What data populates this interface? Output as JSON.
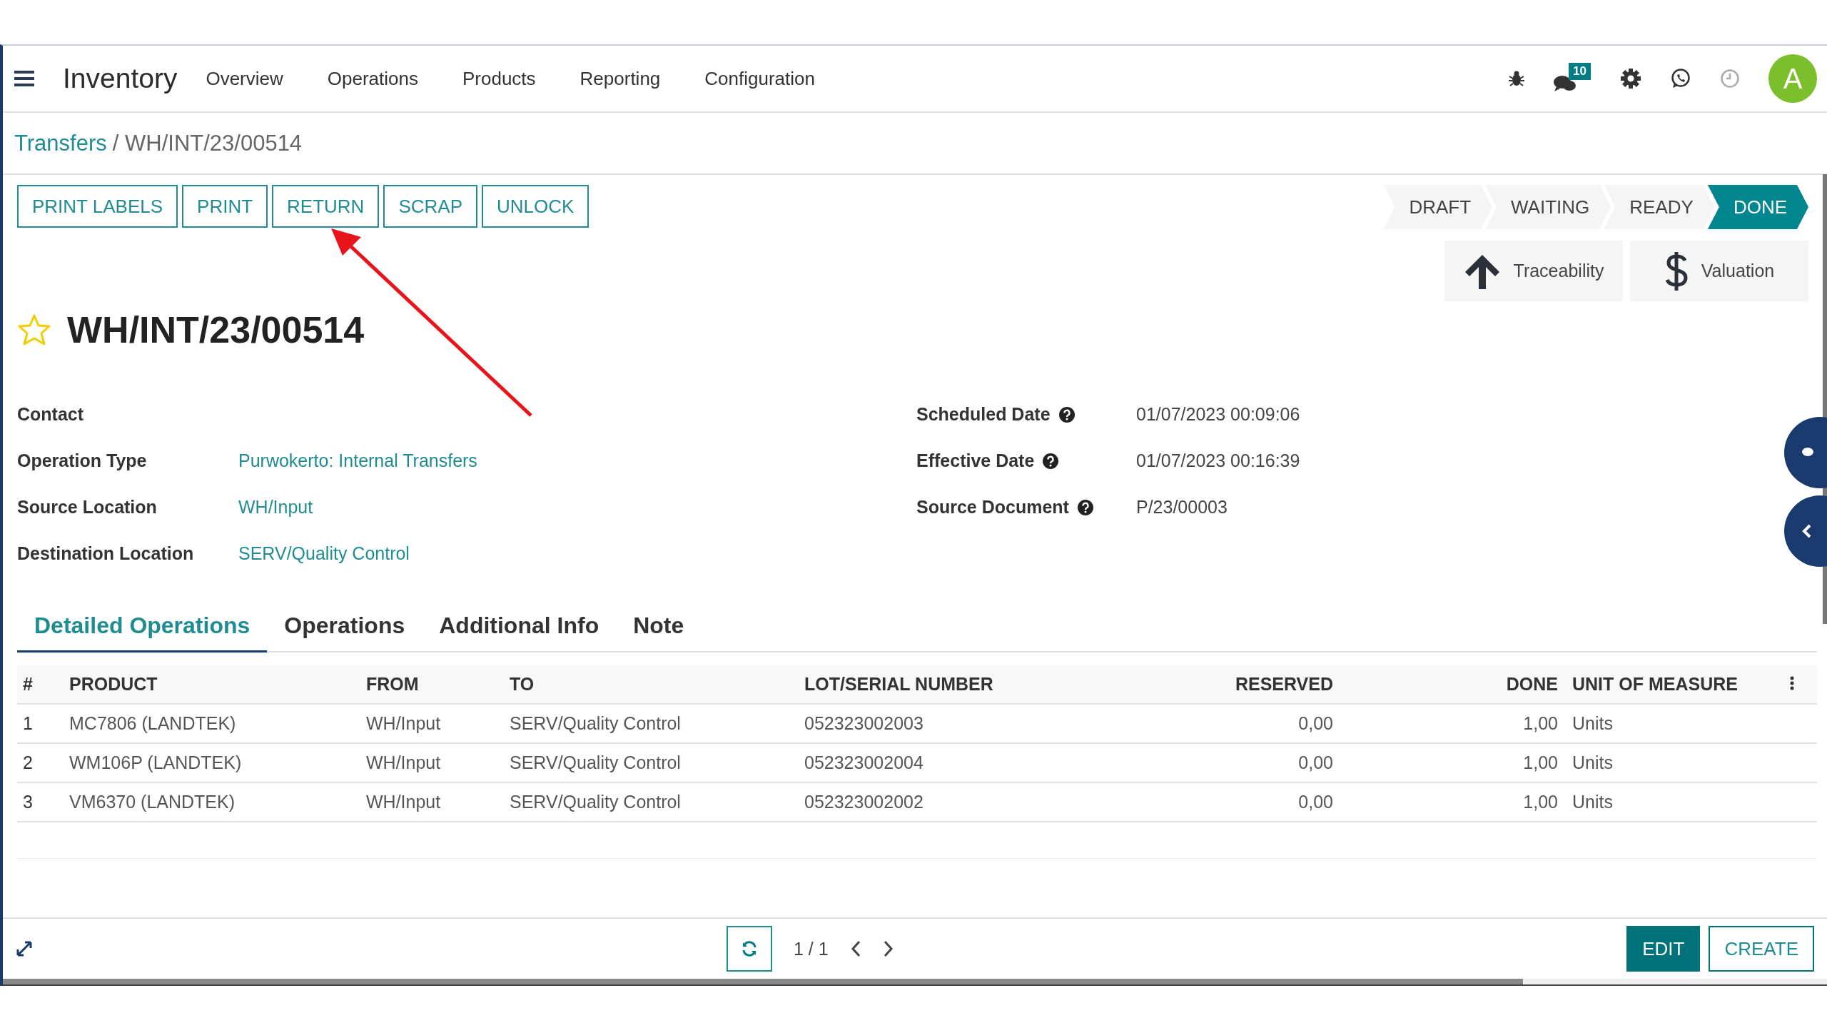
{
  "app": {
    "name": "Inventory",
    "menu": [
      "Overview",
      "Operations",
      "Products",
      "Reporting",
      "Configuration"
    ]
  },
  "systray": {
    "chat_badge": "10",
    "avatar": "A"
  },
  "breadcrumb": {
    "parent": "Transfers",
    "current": "/ WH/INT/23/00514"
  },
  "action_buttons": [
    "PRINT LABELS",
    "PRINT",
    "RETURN",
    "SCRAP",
    "UNLOCK"
  ],
  "status_steps": [
    {
      "label": "DRAFT",
      "selected": false
    },
    {
      "label": "WAITING",
      "selected": false
    },
    {
      "label": "READY",
      "selected": false
    },
    {
      "label": "DONE",
      "selected": true
    }
  ],
  "smart_buttons": [
    {
      "label": "Traceability",
      "kind": "arrow"
    },
    {
      "label": "Valuation",
      "kind": "dollar"
    }
  ],
  "record": {
    "title": "WH/INT/23/00514",
    "starred": false
  },
  "fields_left": [
    {
      "label": "Contact"
    },
    {
      "label": "Operation Type",
      "value": "Purwokerto: Internal Transfers"
    },
    {
      "label": "Source Location",
      "value": "WH/Input"
    },
    {
      "label": "Destination Location",
      "value": "SERV/Quality Control"
    }
  ],
  "fields_right": [
    {
      "label": "Scheduled Date",
      "value": "01/07/2023 00:09:06"
    },
    {
      "label": "Effective Date",
      "value": "01/07/2023 00:16:39"
    },
    {
      "label": "Source Document",
      "value": "P/23/00003"
    }
  ],
  "tabs": [
    {
      "label": "Detailed Operations",
      "selected": true
    },
    {
      "label": "Operations",
      "selected": false
    },
    {
      "label": "Additional Info",
      "selected": false
    },
    {
      "label": "Note",
      "selected": false
    }
  ],
  "table": {
    "columns": [
      {
        "label": "#",
        "kind": "text"
      },
      {
        "label": "PRODUCT",
        "kind": "text"
      },
      {
        "label": "FROM",
        "kind": "text"
      },
      {
        "label": "TO",
        "kind": "text"
      },
      {
        "label": "LOT/SERIAL NUMBER",
        "kind": "text"
      },
      {
        "label": "RESERVED",
        "kind": "number"
      },
      {
        "label": "DONE",
        "kind": "number"
      },
      {
        "label": "UNIT OF MEASURE",
        "kind": "text"
      }
    ],
    "rows": [
      [
        "1",
        "MC7806 (LANDTEK)",
        "WH/Input",
        "SERV/Quality Control",
        "052323002003",
        "0,00",
        "1,00",
        "Units"
      ],
      [
        "2",
        "WM106P (LANDTEK)",
        "WH/Input",
        "SERV/Quality Control",
        "052323002004",
        "0,00",
        "1,00",
        "Units"
      ],
      [
        "3",
        "VM6370 (LANDTEK)",
        "WH/Input",
        "SERV/Quality Control",
        "052323002002",
        "0,00",
        "1,00",
        "Units"
      ]
    ]
  },
  "pager": "1 / 1",
  "bottom_buttons": [
    {
      "label": "EDIT",
      "kind": "primary"
    },
    {
      "label": "CREATE",
      "kind": "secondary"
    }
  ]
}
